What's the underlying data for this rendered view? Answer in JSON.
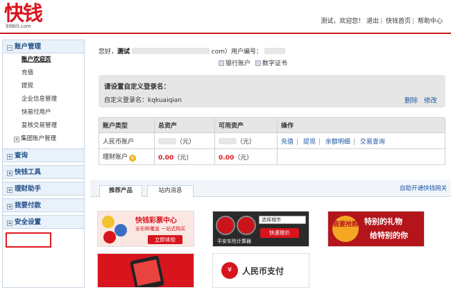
{
  "header": {
    "logo_text": "快钱",
    "logo_sub": "99Bill.com",
    "greeting": "测试，欢迎您！",
    "links": [
      "退出",
      "快钱首页",
      "帮助中心"
    ]
  },
  "sidebar": {
    "groups": [
      {
        "label": "账户管理",
        "expanded_marker": "⊟",
        "items": [
          {
            "label": "账户欢迎页",
            "active": true
          },
          {
            "label": "充值"
          },
          {
            "label": "提现"
          },
          {
            "label": "企业信息管理"
          },
          {
            "label": "快易付用户"
          },
          {
            "label": "复核交易管理"
          },
          {
            "label": "集团账户管理",
            "tree": true
          }
        ]
      },
      {
        "label": "查询",
        "marker": "⊞"
      },
      {
        "label": "快钱工具",
        "marker": "⊞"
      },
      {
        "label": "理财助手",
        "marker": "⊞"
      },
      {
        "label": "我要付款",
        "marker": "⊞",
        "highlighted": true
      },
      {
        "label": "安全设置",
        "marker": "⊞"
      }
    ]
  },
  "account": {
    "hello": "您好，",
    "user": "测试",
    "email_suffix": "com）用户编号：",
    "bank_link": "银行账户",
    "cert_link": "数字证书"
  },
  "login_box": {
    "title": "请设置自定义登录名：",
    "name_label": "自定义登录名：kqkuaiqian",
    "delete": "删除",
    "modify": "修改"
  },
  "assets_table": {
    "headers": [
      "账户类型",
      "总资产",
      "可用资产",
      "操作"
    ],
    "rows": [
      {
        "type": "人民币账户",
        "total": "（元）",
        "available": "（元）",
        "ops": [
          "充值",
          "提现",
          "余额明细",
          "交易查询"
        ]
      },
      {
        "type": "理财账户",
        "total": "0.00",
        "total_unit": "（元）",
        "available": "0.00",
        "available_unit": "（元）",
        "ops": []
      }
    ]
  },
  "promo": {
    "tabs": [
      "推荐产品",
      "站内消息"
    ],
    "gateway_link": "自助开通快钱网关",
    "banners": {
      "lottery_title": "快钱彩票中心",
      "lottery_sub": "全彩种覆盖 一站式购买",
      "lottery_btn": "立即体验",
      "car_label": "平安车险计算器",
      "car_select": "选择城市",
      "car_btn": "快速报价",
      "gift_badge": "我要抢购",
      "gift_line1": "特别的礼物",
      "gift_line2": "给特别的你",
      "rmb_icon": "¥",
      "rmb_text": "人民币支付"
    }
  }
}
